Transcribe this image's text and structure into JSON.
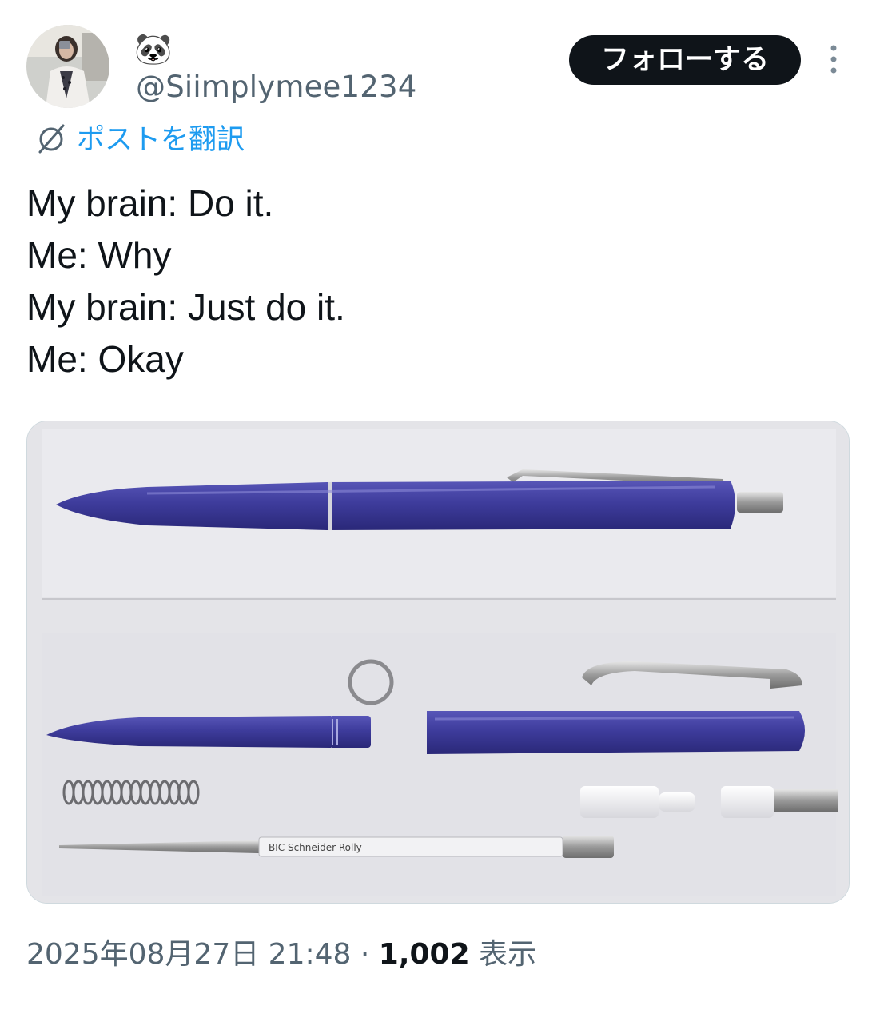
{
  "author": {
    "display_name": "🐼",
    "handle": "@Siimplymee1234"
  },
  "header": {
    "follow_label": "フォローする"
  },
  "translate": {
    "label": "ポストを翻訳"
  },
  "tweet": {
    "lines": [
      "My brain: Do it.",
      "Me: Why",
      "My brain: Just do it.",
      "Me: Okay"
    ]
  },
  "meta": {
    "timestamp": "2025年08月27日 21:48",
    "separator": " · ",
    "view_count": "1,002",
    "view_label": " 表示"
  },
  "media": {
    "refill_print": "BIC Schneider Rolly"
  },
  "colors": {
    "link": "#1d9bf0",
    "follow_bg": "#0f1419",
    "secondary_text": "#536471",
    "pen_blue": "#3c3a96"
  },
  "icons": {
    "translate": "globe-slash-icon",
    "more": "more-vertical-icon"
  }
}
